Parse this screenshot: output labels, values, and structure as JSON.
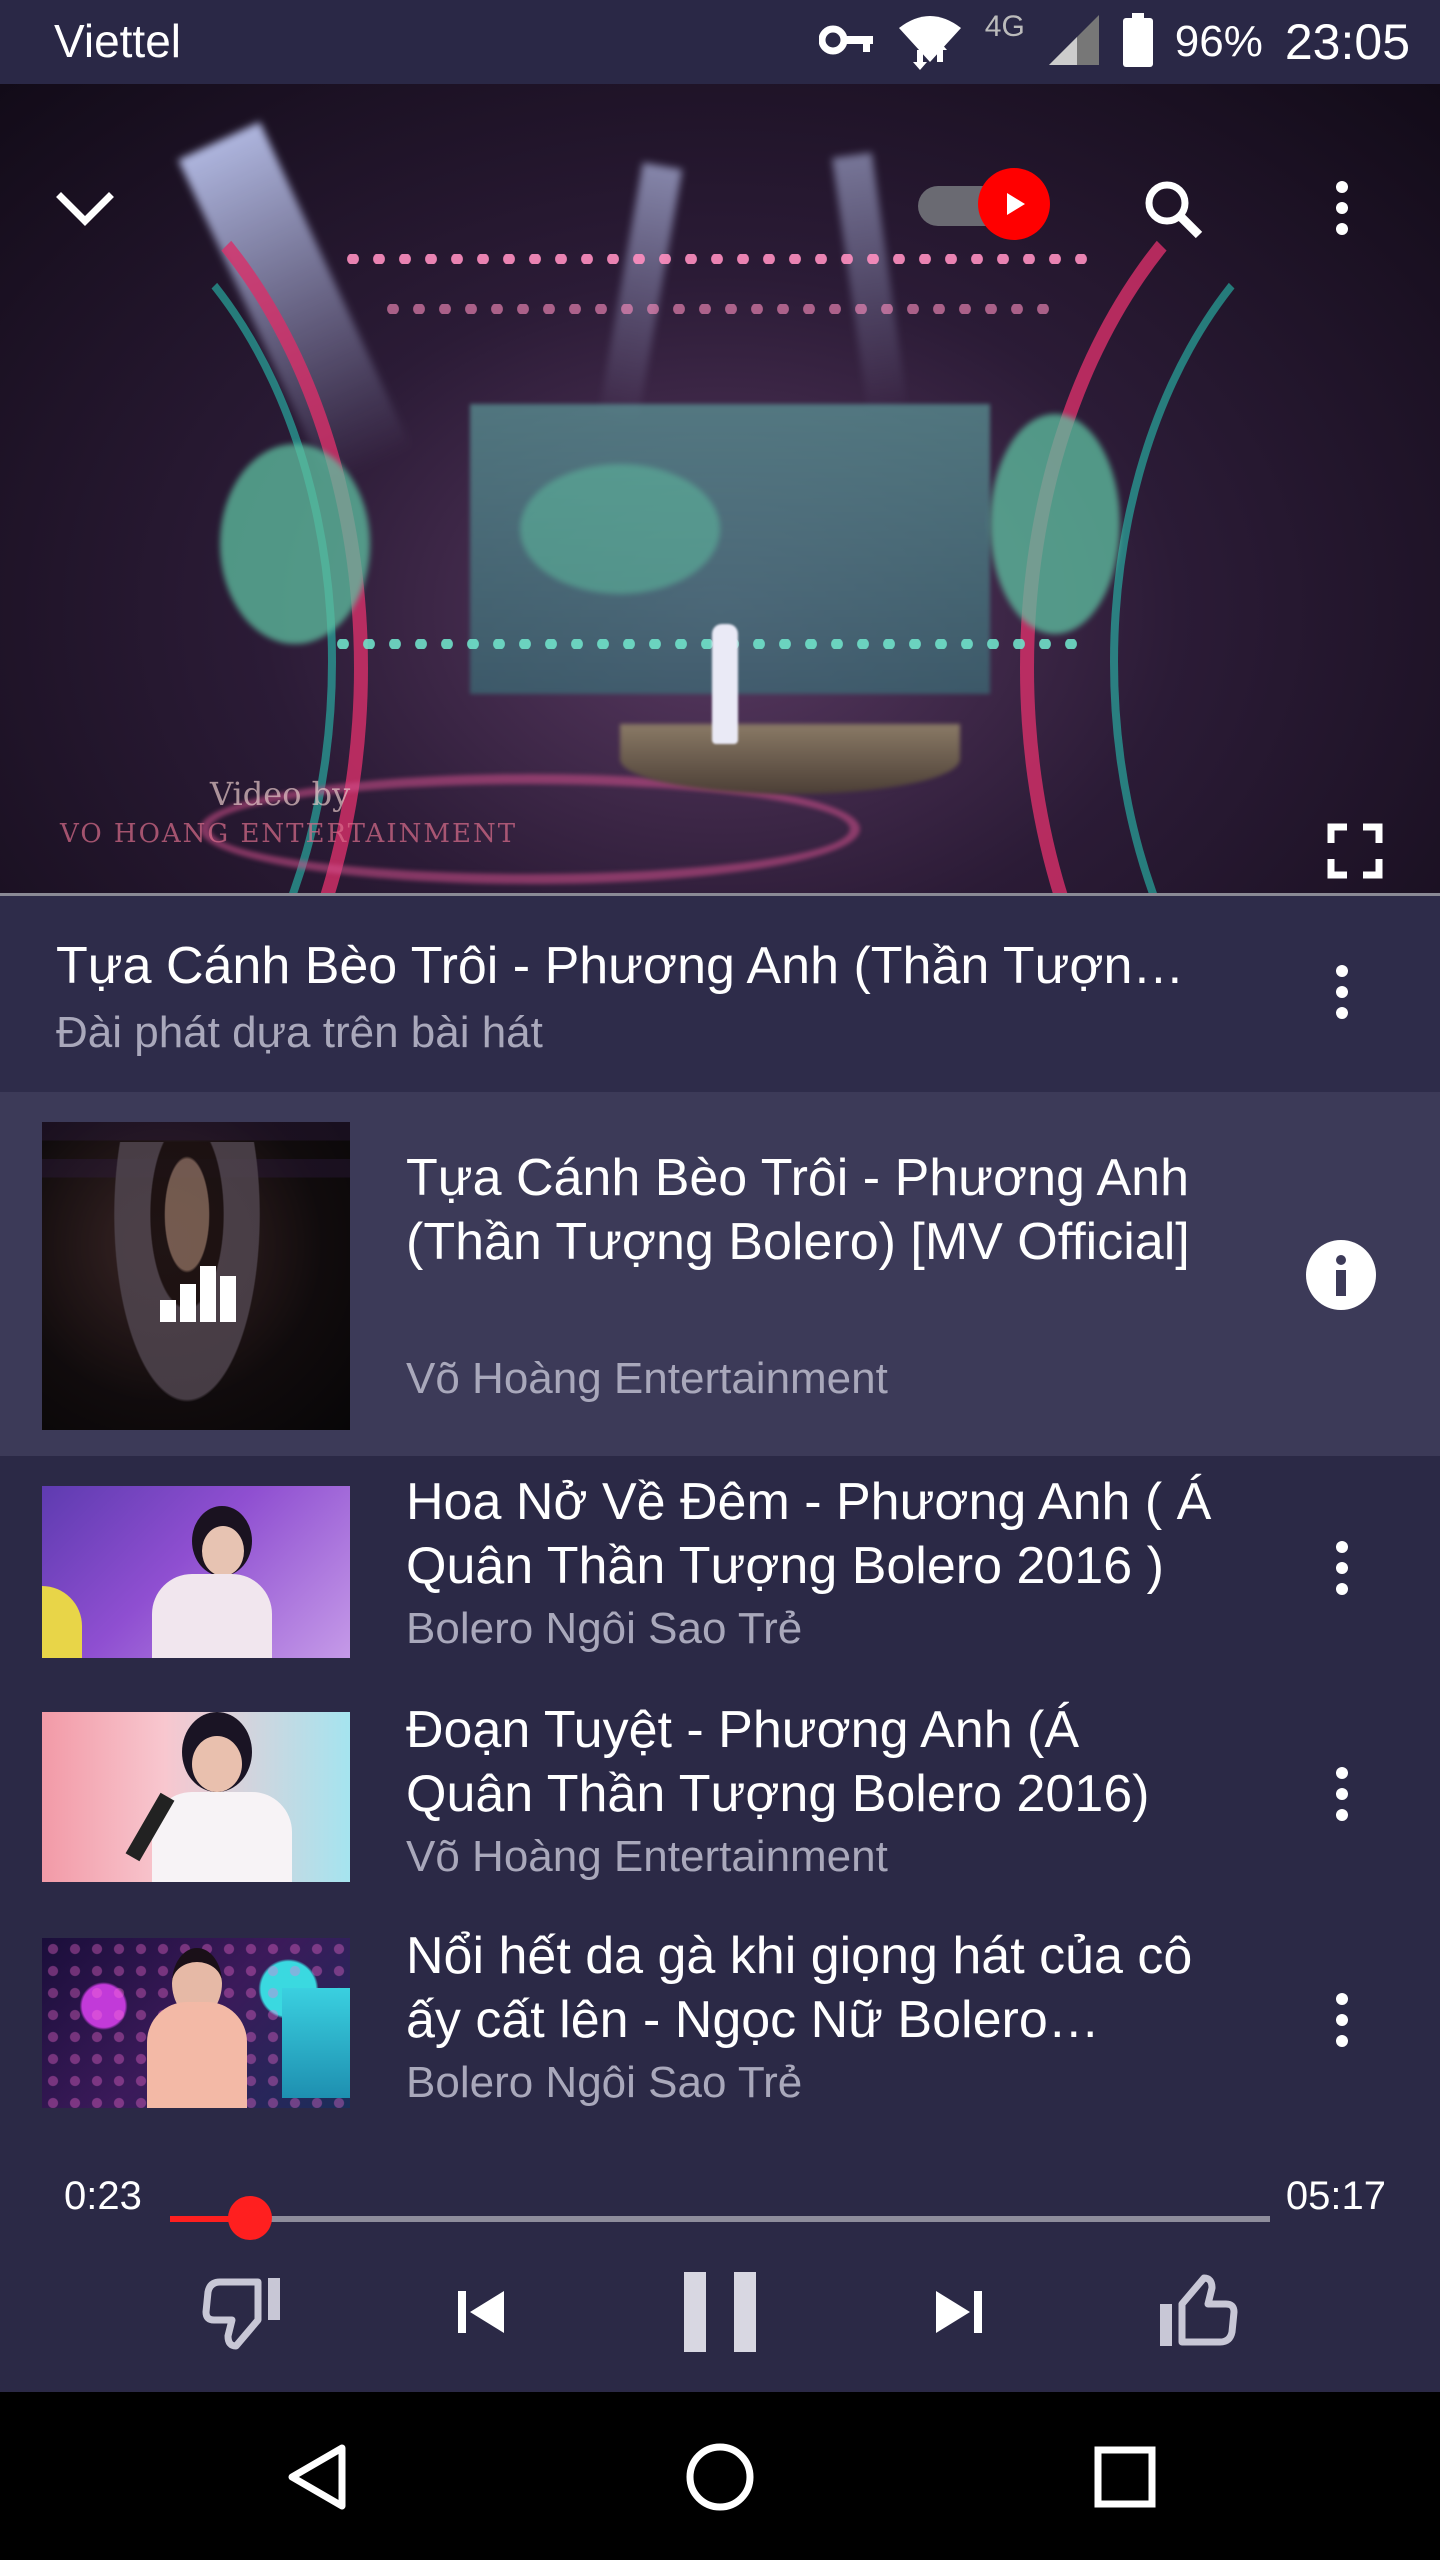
{
  "status_bar": {
    "carrier": "Viettel",
    "network": "4G",
    "battery": "96%",
    "time": "23:05",
    "icons": [
      "vpn-key-icon",
      "wifi-icon",
      "signal-icon",
      "battery-icon"
    ]
  },
  "video": {
    "watermark_line1": "Video by",
    "watermark_line2": "VO HOANG ENTERTAINMENT",
    "icons": [
      "chevron-down-icon",
      "youtube-autoplay-toggle",
      "search-icon",
      "more-vert-icon",
      "fullscreen-icon"
    ]
  },
  "now_playing": {
    "title": "Tựa Cánh Bèo Trôi - Phương Anh (Thần Tượng Bolero) [MV Official]",
    "subtitle": "Đài phát dựa trên bài hát"
  },
  "queue": [
    {
      "title": "Tựa Cánh Bèo Trôi - Phương Anh (Thần Tượng Bolero) [MV Official]",
      "channel": "Võ Hoàng Entertainment",
      "active": true,
      "action_icon": "info-icon"
    },
    {
      "title": "Hoa Nở Về Đêm - Phương Anh ( Á Quân Thần Tượng Bolero 2016 )",
      "channel": "Bolero Ngôi Sao Trẻ",
      "active": false,
      "action_icon": "more-vert-icon"
    },
    {
      "title": "Đoạn Tuyệt - Phương Anh (Á Quân Thần Tượng Bolero 2016)",
      "channel": "Võ Hoàng Entertainment",
      "active": false,
      "action_icon": "more-vert-icon"
    },
    {
      "title": "Nổi hết da gà khi giọng hát của cô ấy cất lên - Ngọc Nữ Bolero Phương Anh",
      "channel": "Bolero Ngôi Sao Trẻ",
      "active": false,
      "action_icon": "more-vert-icon"
    }
  ],
  "player": {
    "current_time": "0:23",
    "duration": "05:17",
    "progress_fraction": 0.073,
    "icons": [
      "thumbs-down-icon",
      "skip-previous-icon",
      "pause-icon",
      "skip-next-icon",
      "thumbs-up-icon"
    ]
  },
  "colors": {
    "background": "#2b2946",
    "accent": "#ff1f1f",
    "secondary_text": "#a9a8bb"
  }
}
